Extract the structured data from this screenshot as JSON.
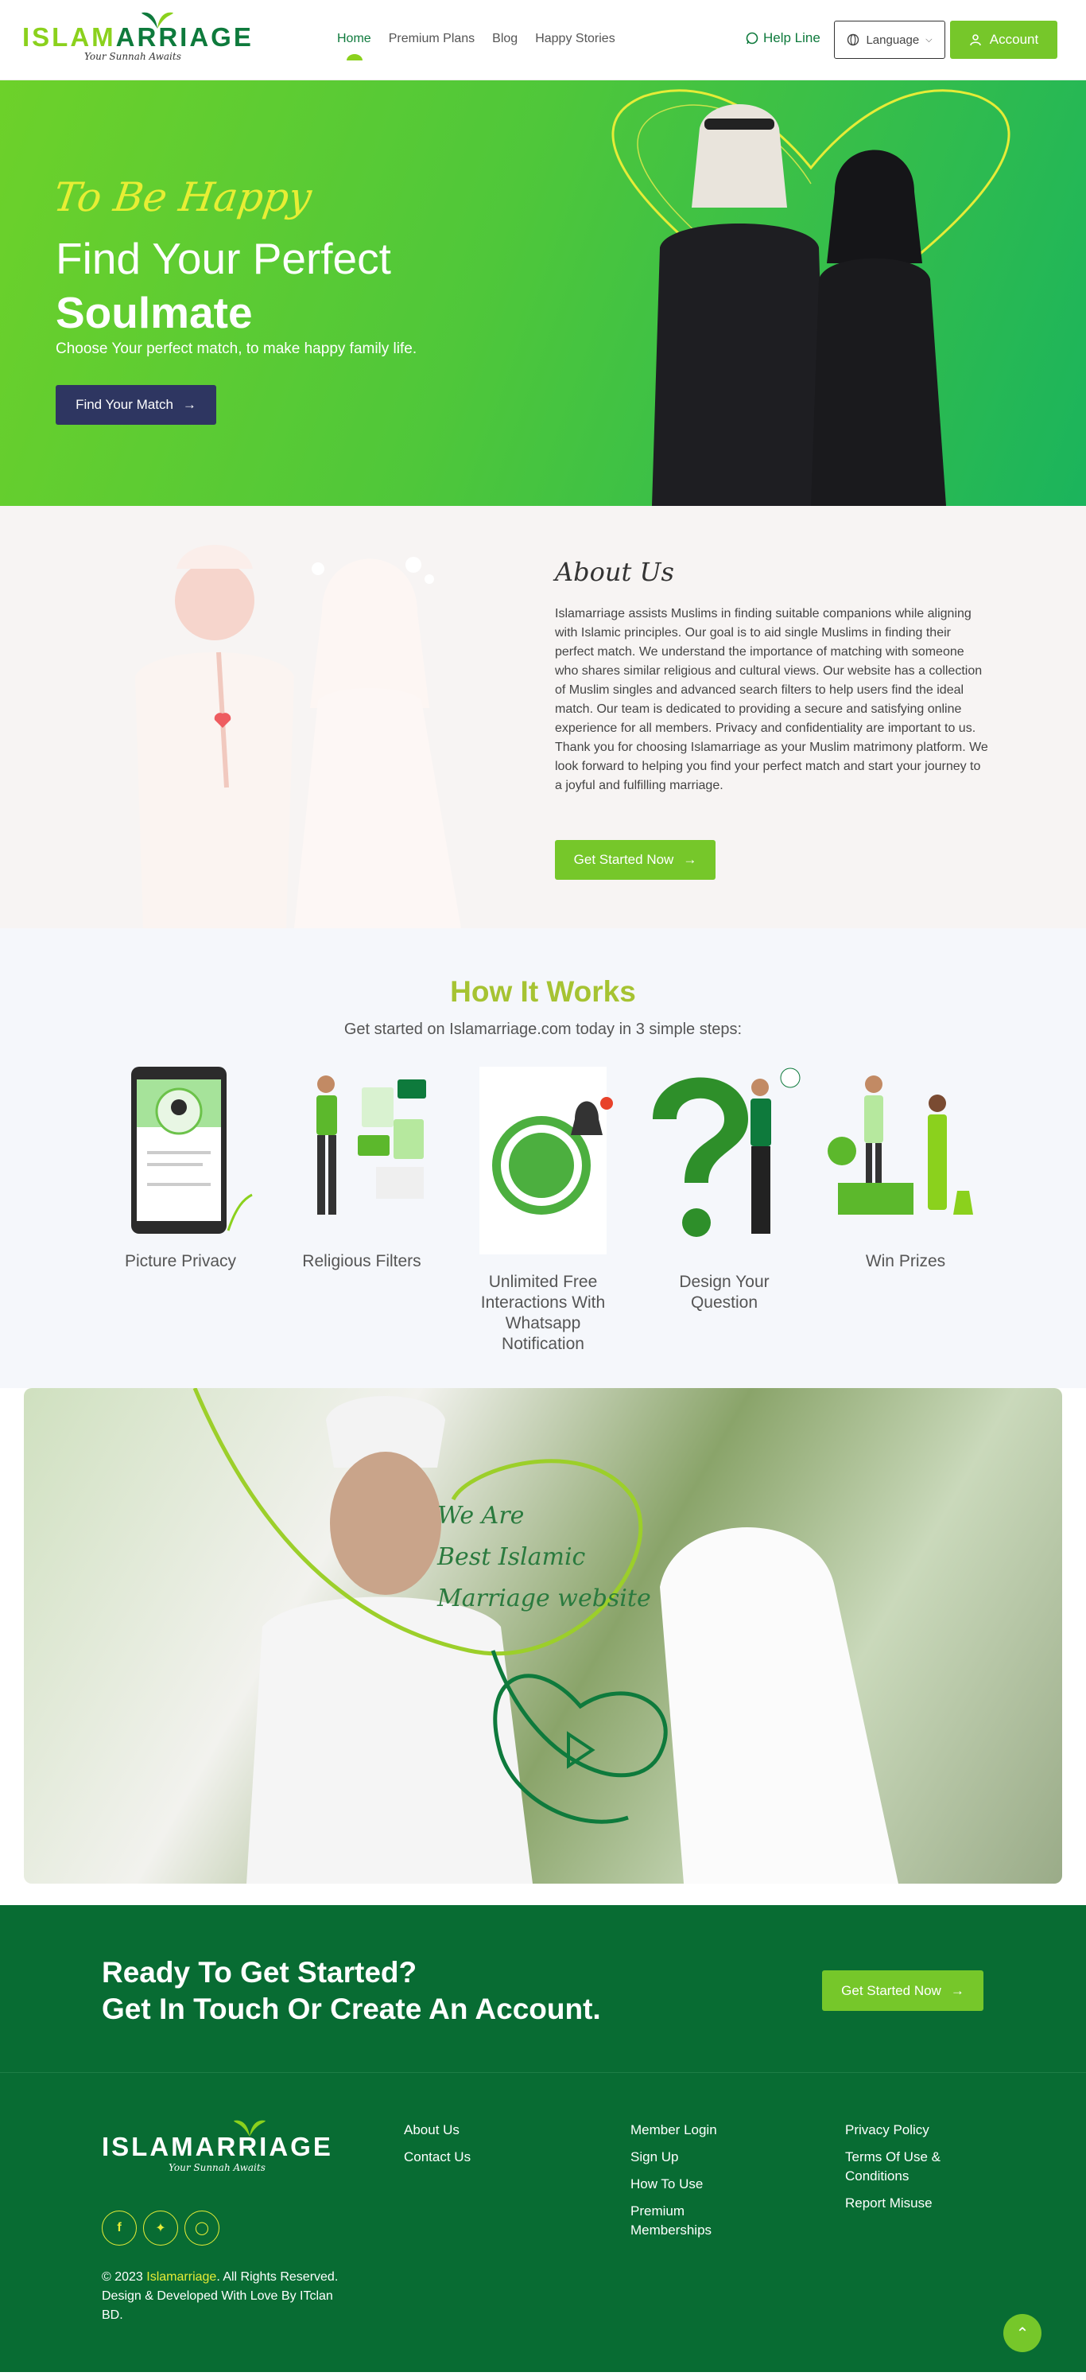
{
  "logo": {
    "word1": "ISLAM",
    "word2": "ARRIAGE",
    "tagline": "Your Sunnah Awaits"
  },
  "nav": {
    "items": [
      "Home",
      "Premium Plans",
      "Blog",
      "Happy Stories"
    ],
    "help": "Help Line",
    "language": "Language",
    "account": "Account"
  },
  "hero": {
    "script": "To Be Happy",
    "title_line1": "Find Your Perfect",
    "title_line2": "Soulmate",
    "subtitle": "Choose Your perfect match, to make happy family life.",
    "button": "Find Your Match"
  },
  "about": {
    "title": "About Us",
    "body": "Islamarriage assists Muslims in finding suitable companions while aligning with Islamic principles. Our goal is to aid single Muslims in finding their perfect match. We understand the importance of matching with someone who shares similar religious and cultural views. Our website has a collection of Muslim singles and advanced search filters to help users find the ideal match. Our team is dedicated to providing a secure and satisfying online experience for all members. Privacy and confidentiality are important to us. Thank you for choosing Islamarriage as your Muslim matrimony platform. We look forward to helping you find your perfect match and start your journey to a joyful and fulfilling marriage.",
    "button": "Get Started Now"
  },
  "how": {
    "title": "How It Works",
    "subtitle": "Get started on Islamarriage.com today in 3 simple steps:",
    "steps": [
      "Picture Privacy",
      "Religious Filters",
      "Unlimited Free Interactions With Whatsapp Notification",
      "Design Your Question",
      "Win Prizes"
    ]
  },
  "video": {
    "line1": "We Are",
    "line2": "Best Islamic",
    "line3": "Marriage website"
  },
  "cta": {
    "line1": "Ready To Get Started?",
    "line2": "Get In Touch Or Create An Account.",
    "button": "Get Started Now"
  },
  "footer": {
    "col1": [
      "About Us",
      "Contact Us"
    ],
    "col2": [
      "Member Login",
      "Sign Up",
      "How To Use",
      "Premium Memberships"
    ],
    "col3": [
      "Privacy Policy",
      "Terms Of Use & Conditions",
      "Report Misuse"
    ],
    "copy_pre": "© 2023 ",
    "copy_brand": "Islamarriage",
    "copy_post": ". All Rights Reserved. Design & Developed With Love By ITclan BD."
  },
  "colors": {
    "brand_green": "#76c72a",
    "dark_green": "#086c33",
    "navy": "#2e3661",
    "accent_yellow": "#e6ec37"
  }
}
